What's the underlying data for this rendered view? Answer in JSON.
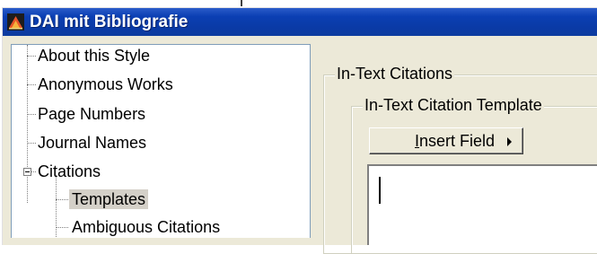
{
  "window": {
    "title": "DAI mit Bibliografie",
    "icon": "app-icon"
  },
  "tree": {
    "items": [
      {
        "label": "About this Style"
      },
      {
        "label": "Anonymous Works"
      },
      {
        "label": "Page Numbers"
      },
      {
        "label": "Journal Names"
      },
      {
        "label": "Citations",
        "expanded": true
      },
      {
        "label": "Templates",
        "selected": true
      },
      {
        "label": "Ambiguous Citations"
      }
    ]
  },
  "panel": {
    "outer_group_label": "In-Text Citations",
    "inner_group_label": "In-Text Citation Template",
    "insert_field": {
      "mnemonic": "I",
      "label_rest": "nsert Field",
      "icon": "triangle-right-icon"
    },
    "template_value": ""
  },
  "colors": {
    "titlebar": "#0a3aa6",
    "face": "#ece9d8",
    "selection": "#d4d0c8"
  }
}
